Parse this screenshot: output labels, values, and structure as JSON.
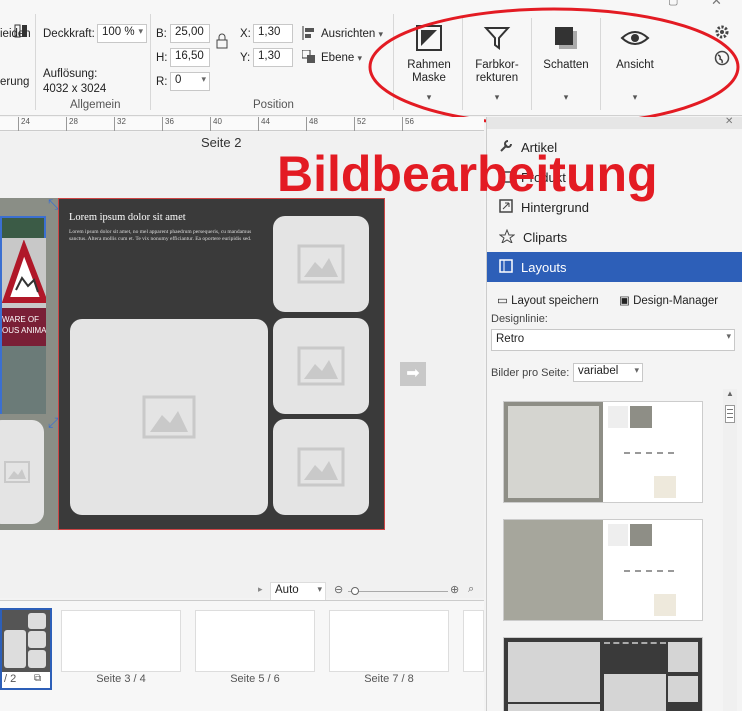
{
  "ribbon": {
    "partial_left_top": "ieiden",
    "partial_left_bottom": "erung",
    "opacity_label": "Deckkraft:",
    "opacity_value": "100 %",
    "resolution_label": "Auflösung:",
    "resolution_value": "4032 x 3024",
    "group_general": "Allgemein",
    "b_label": "B:",
    "b_value": "25,00",
    "h_label": "H:",
    "h_value": "16,50",
    "r_label": "R:",
    "r_value": "0",
    "x_label": "X:",
    "x_value": "1,30",
    "y_label": "Y:",
    "y_value": "1,30",
    "align_label": "Ausrichten",
    "layer_label": "Ebene",
    "group_position": "Position",
    "frame_mask_line1": "Rahmen",
    "frame_mask_line2": "Maske",
    "color_corr_line1": "Farbkor-",
    "color_corr_line2": "rekturen",
    "shadow_label": "Schatten",
    "view_label": "Ansicht"
  },
  "annotation": {
    "text": "Bildbearbeitung",
    "color": "#e31b23"
  },
  "ruler": {
    "ticks": [
      "24",
      "28",
      "32",
      "36",
      "40",
      "44",
      "48",
      "52",
      "56"
    ]
  },
  "canvas": {
    "page_title": "Seite 2",
    "page_bg": "#3a3a3a",
    "text_heading": "Lorem ipsum dolor sit amet",
    "text_body": "Lorem ipsum dolor sit amet, no mel apparent phaedrum persequeris, cu mandamus sanctus. Altera mollis cum et. Te vix nonumy efficiantur. Ea oportere euripidis sed.",
    "sign_line1": "WARE OF",
    "sign_line2": "OUS ANIMA"
  },
  "panel": {
    "nav_items": [
      "Artikel",
      "Produkt",
      "Hintergrund",
      "Cliparts",
      "Layouts"
    ],
    "active_item": "Layouts",
    "active_color": "#2d5fb8",
    "save_layout": "Layout speichern",
    "design_manager": "Design-Manager",
    "design_line_label": "Designlinie:",
    "design_line_value": "Retro",
    "images_per_page_label": "Bilder pro Seite:",
    "images_per_page_value": "variabel"
  },
  "zoom": {
    "value": "Auto"
  },
  "pages": {
    "current_label": "/ 2",
    "labels": [
      "Seite 3 / 4",
      "Seite 5 / 6",
      "Seite 7 / 8"
    ]
  }
}
